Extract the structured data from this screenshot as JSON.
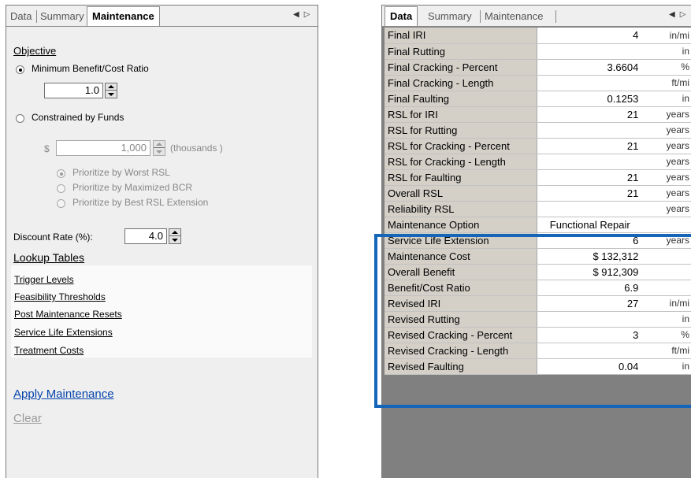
{
  "left_panel": {
    "tabs": [
      "Data",
      "Summary",
      "Maintenance"
    ],
    "active_tab": "Maintenance",
    "nav_icons": [
      "arrow-left-icon",
      "arrow-right-icon"
    ],
    "objective": {
      "heading": "Objective",
      "min_bcr_label": "Minimum Benefit/Cost Ratio",
      "min_bcr_value": "1.0",
      "min_bcr_selected": true,
      "constrained_label": "Constrained by Funds",
      "currency_symbol": "$",
      "funds_value": "1,000",
      "funds_unit": "(thousands )",
      "prioritize_options": [
        "Prioritize by Worst RSL",
        "Prioritize by Maximized BCR",
        "Prioritize by Best RSL Extension"
      ],
      "prioritize_selected_index": 0
    },
    "discount_rate": {
      "label": "Discount Rate (%):",
      "value": "4.0"
    },
    "lookup_tables": {
      "heading": "Lookup Tables",
      "links": [
        "Trigger Levels",
        "Feasibility Thresholds",
        "Post Maintenance Resets",
        "Service Life Extensions",
        "Treatment Costs"
      ]
    },
    "apply_label": "Apply Maintenance",
    "clear_label": "Clear"
  },
  "right_panel": {
    "tabs": [
      "Data",
      "Summary",
      "Maintenance"
    ],
    "active_tab": "Data",
    "nav_icons": [
      "arrow-left-icon",
      "arrow-right-icon"
    ],
    "rows": [
      {
        "name": "Final IRI",
        "value": "4",
        "unit": "in/mi"
      },
      {
        "name": "Final Rutting",
        "value": "",
        "unit": "in"
      },
      {
        "name": "Final Cracking - Percent",
        "value": "3.6604",
        "unit": "%"
      },
      {
        "name": "Final Cracking - Length",
        "value": "",
        "unit": "ft/mi"
      },
      {
        "name": "Final Faulting",
        "value": "0.1253",
        "unit": "in"
      },
      {
        "name": "RSL for IRI",
        "value": "21",
        "unit": "years"
      },
      {
        "name": "RSL for Rutting",
        "value": "",
        "unit": "years"
      },
      {
        "name": "RSL for Cracking - Percent",
        "value": "21",
        "unit": "years"
      },
      {
        "name": "RSL for Cracking - Length",
        "value": "",
        "unit": "years"
      },
      {
        "name": "RSL for Faulting",
        "value": "21",
        "unit": "years"
      },
      {
        "name": "Overall RSL",
        "value": "21",
        "unit": "years"
      },
      {
        "name": "Reliability RSL",
        "value": "",
        "unit": "years"
      },
      {
        "name": "Maintenance Option",
        "value": "Functional Repair",
        "unit": ""
      },
      {
        "name": "Service Life Extension",
        "value": "6",
        "unit": "years"
      },
      {
        "name": "Maintenance Cost",
        "value": "$ 132,312",
        "unit": ""
      },
      {
        "name": "Overall Benefit",
        "value": "$ 912,309",
        "unit": ""
      },
      {
        "name": "Benefit/Cost Ratio",
        "value": "6.9",
        "unit": ""
      },
      {
        "name": "Revised IRI",
        "value": "27",
        "unit": "in/mi"
      },
      {
        "name": "Revised Rutting",
        "value": "",
        "unit": "in"
      },
      {
        "name": "Revised Cracking - Percent",
        "value": "3",
        "unit": "%"
      },
      {
        "name": "Revised Cracking - Length",
        "value": "",
        "unit": "ft/mi"
      },
      {
        "name": "Revised Faulting",
        "value": "0.04",
        "unit": "in"
      }
    ],
    "highlight_color": "#1565b8",
    "grid_header_color": "#d4d0c8",
    "empty_area_color": "#808080"
  }
}
